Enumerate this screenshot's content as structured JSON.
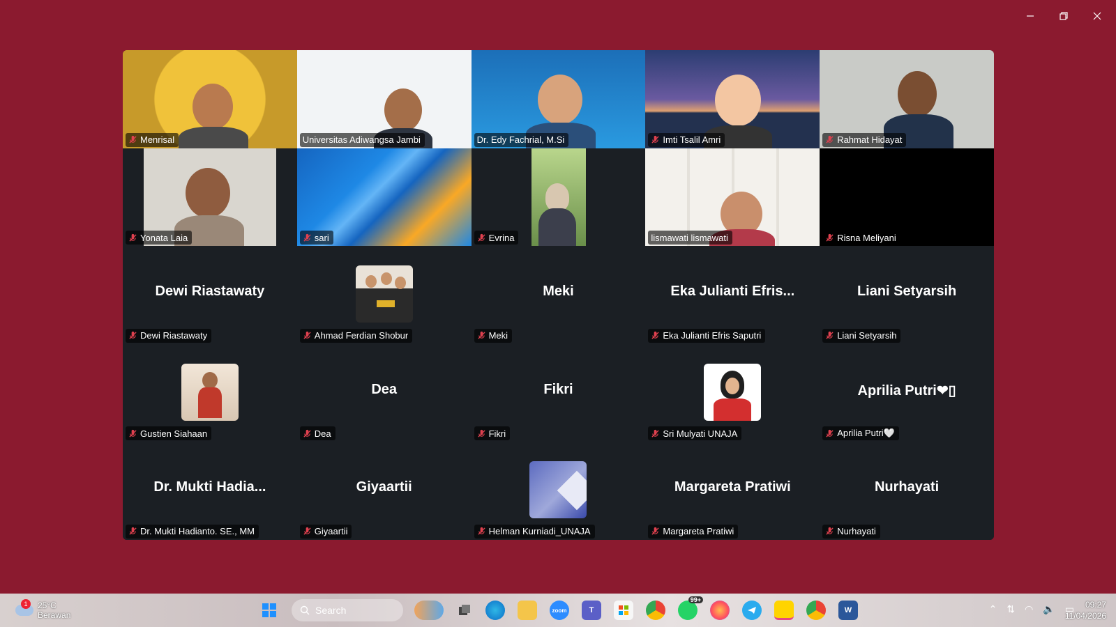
{
  "window": {
    "minimize_label": "Minimize",
    "restore_label": "Restore",
    "close_label": "Close"
  },
  "colors": {
    "background": "#8b1a2f",
    "gallery_bg": "#1b1f24",
    "active_speaker_border": "#2ecc71",
    "muted_mic": "#e0414f"
  },
  "participants": [
    {
      "name": "Menrisal",
      "muted": true,
      "view": "video"
    },
    {
      "name": "Universitas Adiwangsa Jambi",
      "muted": false,
      "view": "video"
    },
    {
      "name": "Dr. Edy Fachrial, M.Si",
      "muted": false,
      "view": "video",
      "active_speaker": true
    },
    {
      "name": "Imti Tsalil Amri",
      "muted": true,
      "view": "video"
    },
    {
      "name": "Rahmat Hidayat",
      "muted": true,
      "view": "video"
    },
    {
      "name": "Yonata Laia",
      "muted": true,
      "view": "video"
    },
    {
      "name": "sari",
      "muted": true,
      "view": "video"
    },
    {
      "name": "Evrina",
      "muted": true,
      "view": "video"
    },
    {
      "name": "lismawati lismawati",
      "muted": false,
      "view": "video"
    },
    {
      "name": "Risna Meliyani",
      "muted": true,
      "view": "black"
    },
    {
      "name": "Dewi Riastawaty",
      "display": "Dewi Riastawaty",
      "muted": true,
      "view": "name"
    },
    {
      "name": "Ahmad Ferdian Shobur",
      "muted": true,
      "view": "avatar"
    },
    {
      "name": "Meki",
      "display": "Meki",
      "muted": true,
      "view": "name"
    },
    {
      "name": "Eka Julianti Efris Saputri",
      "display": "Eka Julianti Efris...",
      "muted": true,
      "view": "name"
    },
    {
      "name": "Liani Setyarsih",
      "display": "Liani Setyarsih",
      "muted": true,
      "view": "name"
    },
    {
      "name": "Gustien Siahaan",
      "muted": true,
      "view": "avatar"
    },
    {
      "name": "Dea",
      "display": "Dea",
      "muted": true,
      "view": "name"
    },
    {
      "name": "Fikri",
      "display": "Fikri",
      "muted": true,
      "view": "name"
    },
    {
      "name": "Sri Mulyati UNAJA",
      "muted": true,
      "view": "avatar"
    },
    {
      "name": "Aprilia Putri🤍",
      "display": "Aprilia Putri❤▯",
      "muted": true,
      "view": "name"
    },
    {
      "name": "Dr. Mukti Hadianto. SE., MM",
      "display": "Dr. Mukti Hadia...",
      "muted": true,
      "view": "name"
    },
    {
      "name": "Giyaartii",
      "display": "Giyaartii",
      "muted": true,
      "view": "name"
    },
    {
      "name": "Helman Kurniadi_UNAJA",
      "muted": true,
      "view": "avatar"
    },
    {
      "name": "Margareta Pratiwi",
      "display": "Margareta Pratiwi",
      "muted": true,
      "view": "name"
    },
    {
      "name": "Nurhayati",
      "display": "Nurhayati",
      "muted": true,
      "view": "name"
    }
  ],
  "taskbar": {
    "weather_temp": "25°C",
    "weather_desc": "Berawan",
    "weather_badge": "1",
    "search_placeholder": "Search",
    "whatsapp_badge": "99+",
    "time": "09:27",
    "date": "11/04/2026",
    "apps": [
      "windows-start",
      "search",
      "copilot",
      "task-view",
      "edge",
      "file-explorer",
      "zoom",
      "teams",
      "store",
      "chrome",
      "whatsapp",
      "firefox",
      "telegram",
      "sticky-notes",
      "chrome-profile",
      "word"
    ]
  }
}
